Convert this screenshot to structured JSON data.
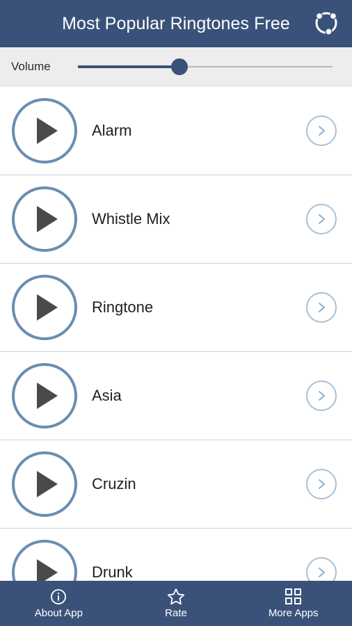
{
  "header": {
    "title": "Most Popular Ringtones Free",
    "action_icon": "share-network-icon",
    "background_color": "#3a5279"
  },
  "volume": {
    "label": "Volume",
    "value_percent": 40,
    "fill_color": "#3a5279",
    "track_color": "#b9b9b9",
    "background_color": "#ededed"
  },
  "ringtones": [
    {
      "name": "Alarm"
    },
    {
      "name": "Whistle Mix"
    },
    {
      "name": "Ringtone"
    },
    {
      "name": "Asia"
    },
    {
      "name": "Cruzin"
    },
    {
      "name": "Drunk"
    }
  ],
  "row_icons": {
    "play": "play-icon",
    "chevron": "chevron-right-icon",
    "play_ring_color": "#6b8db2",
    "chevron_ring_color": "#a8c0d6"
  },
  "bottom_nav": {
    "items": [
      {
        "label": "About App",
        "icon": "info-icon"
      },
      {
        "label": "Rate",
        "icon": "star-icon"
      },
      {
        "label": "More Apps",
        "icon": "grid-icon"
      }
    ],
    "background_color": "#3a5279"
  }
}
